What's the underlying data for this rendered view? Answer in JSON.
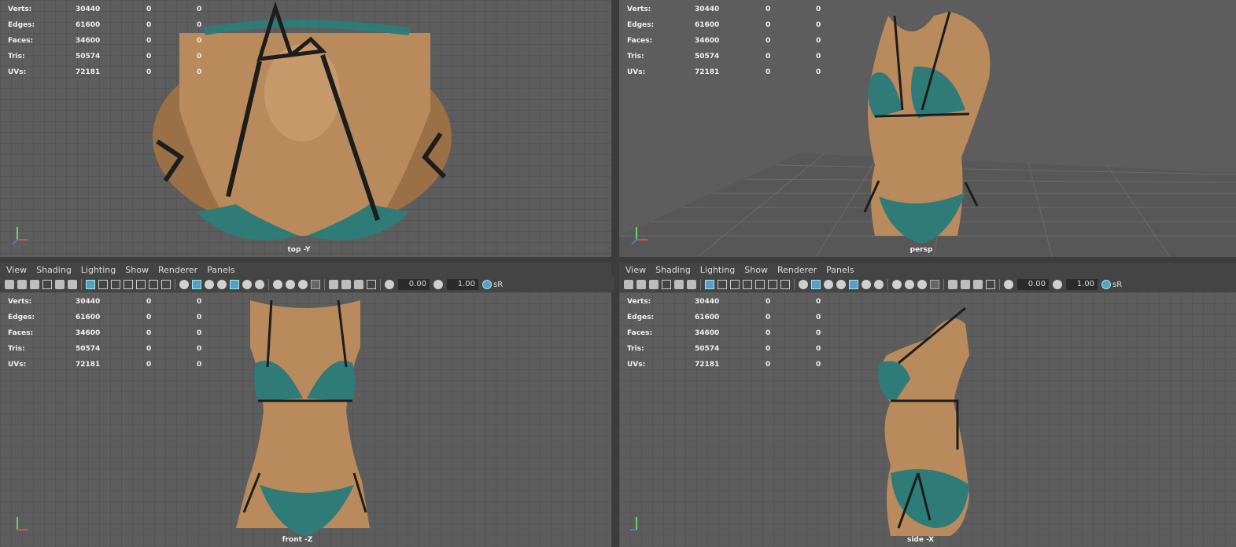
{
  "menus": [
    "View",
    "Shading",
    "Lighting",
    "Show",
    "Renderer",
    "Panels"
  ],
  "toolbar": {
    "field1": "0.00",
    "field2": "1.00",
    "color_mgmt": "sR"
  },
  "hud": [
    {
      "label": "Verts:",
      "v1": "30440",
      "v2": "0",
      "v3": "0"
    },
    {
      "label": "Edges:",
      "v1": "61600",
      "v2": "0",
      "v3": "0"
    },
    {
      "label": "Faces:",
      "v1": "34600",
      "v2": "0",
      "v3": "0"
    },
    {
      "label": "Tris:",
      "v1": "50574",
      "v2": "0",
      "v3": "0"
    },
    {
      "label": "UVs:",
      "v1": "72181",
      "v2": "0",
      "v3": "0"
    }
  ],
  "viewports": {
    "top": {
      "camera": "top -Y"
    },
    "persp": {
      "camera": "persp"
    },
    "front": {
      "camera": "front -Z"
    },
    "side": {
      "camera": "side -X"
    }
  },
  "colors": {
    "skin": "#b98a5c",
    "fabric": "#2f7b78",
    "strap": "#1d1d1d",
    "viewport_bg": "#5d5d5d"
  }
}
